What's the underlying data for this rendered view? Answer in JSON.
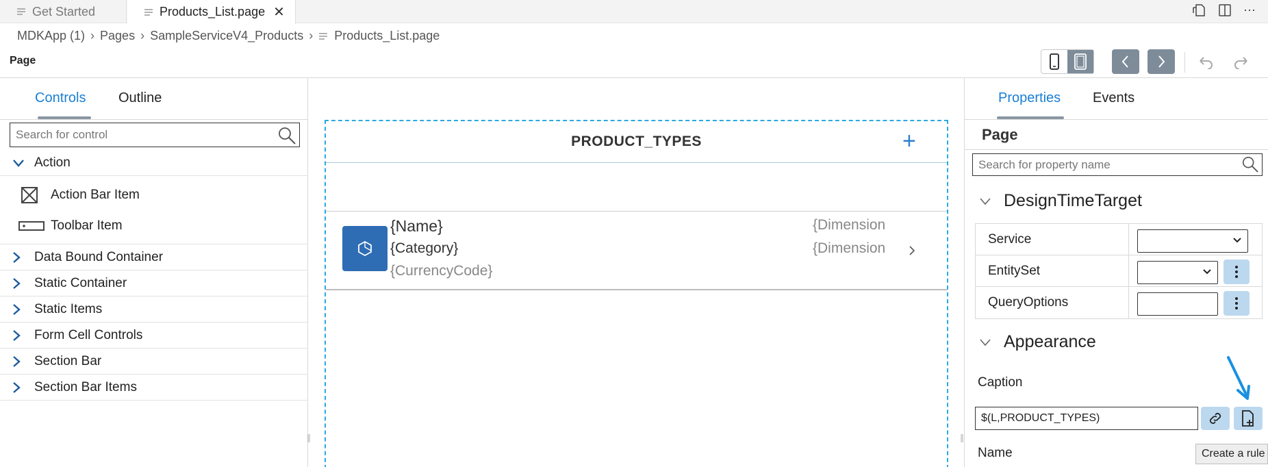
{
  "tabs": [
    {
      "label": "Get Started"
    },
    {
      "label": "Products_List.page"
    }
  ],
  "breadcrumb": [
    "MDKApp (1)",
    "Pages",
    "SampleServiceV4_Products",
    "Products_List.page"
  ],
  "page_label": "Page",
  "left_panel": {
    "tabs": [
      "Controls",
      "Outline"
    ],
    "search_placeholder": "Search for control",
    "action_group": "Action",
    "action_items": [
      "Action Bar Item",
      "Toolbar Item"
    ],
    "groups": [
      "Data Bound Container",
      "Static Container",
      "Static Items",
      "Form Cell Controls",
      "Section Bar",
      "Section Bar Items"
    ]
  },
  "canvas": {
    "title": "PRODUCT_TYPES",
    "row": {
      "name": "{Name}",
      "category": "{Category}",
      "currency": "{CurrencyCode}",
      "dim1": "{Dimension",
      "dim2": "{Dimension"
    }
  },
  "right_panel": {
    "tabs": [
      "Properties",
      "Events"
    ],
    "heading": "Page",
    "search_placeholder": "Search for property name",
    "design_section": "DesignTimeTarget",
    "design_rows": [
      "Service",
      "EntitySet",
      "QueryOptions"
    ],
    "appearance_section": "Appearance",
    "caption_label": "Caption",
    "caption_value": "$(L,PRODUCT_TYPES)",
    "name_label": "Name",
    "tooltip": "Create a rule"
  },
  "colors": {
    "accent": "#1a7fd4",
    "canvas_border": "#2aa9e0",
    "icon_tile": "#2e6db4",
    "nav_button": "#7e8c9a",
    "soft_button": "#bcd8ef"
  }
}
